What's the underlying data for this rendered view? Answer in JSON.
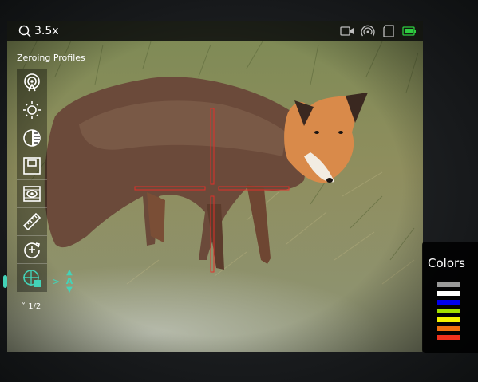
{
  "topbar": {
    "zoom_label": "3.5x",
    "icons": [
      "video-record-icon",
      "wifi-hotspot-icon",
      "sd-card-icon",
      "battery-icon"
    ],
    "battery_color": "#2ecc40"
  },
  "menu": {
    "title": "Zeroing  Profiles",
    "items": [
      {
        "icon": "hotspot-icon"
      },
      {
        "icon": "brightness-icon"
      },
      {
        "icon": "contrast-icon"
      },
      {
        "icon": "picture-in-picture-icon"
      },
      {
        "icon": "image-mode-icon"
      },
      {
        "icon": "ruler-icon"
      },
      {
        "icon": "zeroing-reset-icon"
      },
      {
        "icon": "reticle-settings-icon",
        "active": true
      }
    ],
    "sub_arrow": ">",
    "sub_value": "A",
    "page_indicator": "1/2",
    "accent_color": "#43d3b8"
  },
  "colors_panel": {
    "title": "Colors",
    "swatches": [
      "#9a9a9a",
      "#ffffff",
      "#0000ee",
      "#a4e000",
      "#f4f400",
      "#f07010",
      "#f0301c"
    ]
  },
  "reticle": {
    "color": "#e2302a"
  }
}
